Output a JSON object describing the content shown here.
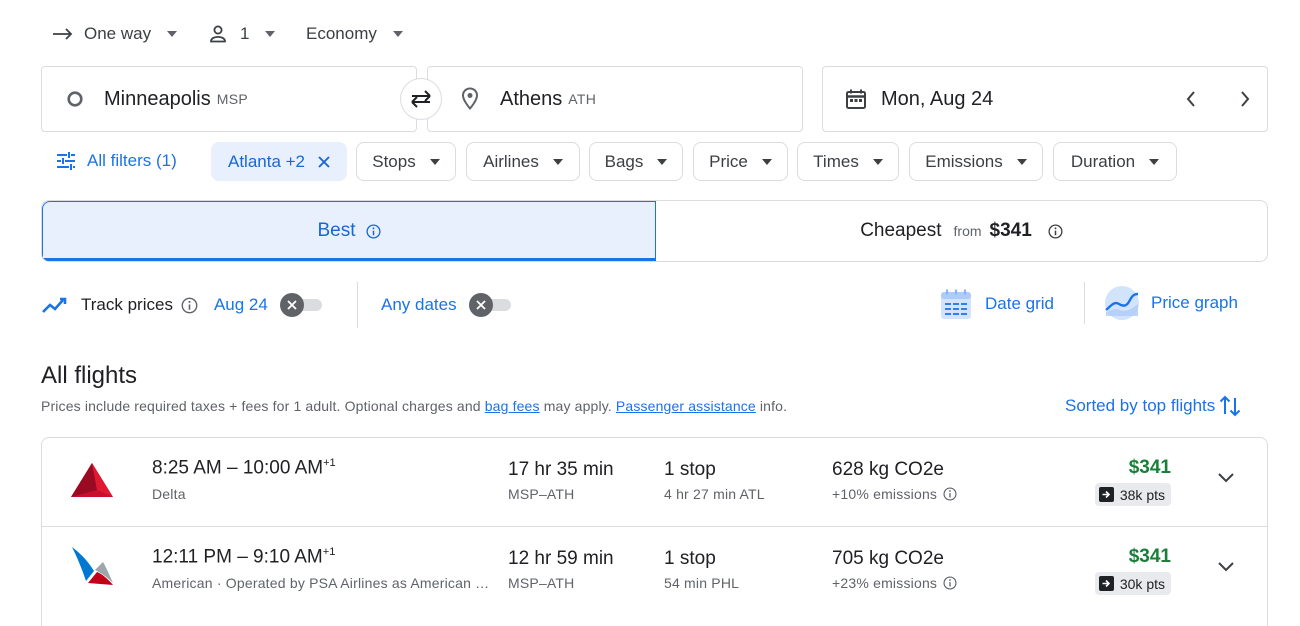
{
  "search": {
    "trip_type": "One way",
    "passengers": "1",
    "cabin": "Economy",
    "origin_city": "Minneapolis",
    "origin_code": "MSP",
    "dest_city": "Athens",
    "dest_code": "ATH",
    "date": "Mon, Aug 24"
  },
  "filters": {
    "all_filters": "All filters (1)",
    "active_chip": "Atlanta +2",
    "chips": [
      "Stops",
      "Airlines",
      "Bags",
      "Price",
      "Times",
      "Emissions",
      "Duration"
    ]
  },
  "tabs": {
    "best": "Best",
    "cheapest": "Cheapest",
    "from": "from",
    "cheapest_price": "$341"
  },
  "tracking": {
    "label": "Track prices",
    "date": "Aug 24",
    "any_dates": "Any dates",
    "date_grid": "Date grid",
    "price_graph": "Price graph"
  },
  "results": {
    "heading": "All flights",
    "note_a": "Prices include required taxes + fees for 1 adult. Optional charges and ",
    "bag_fees": "bag fees",
    "note_b": " may apply. ",
    "passenger_assistance": "Passenger assistance",
    "note_c": " info.",
    "sort_label": "Sorted by top flights"
  },
  "flights": [
    {
      "depart": "8:25 AM",
      "arrive": "10:00 AM",
      "day_offset": "+1",
      "airline": "Delta",
      "duration": "17 hr 35 min",
      "route": "MSP–ATH",
      "stops": "1 stop",
      "layover": "4 hr 27 min ATL",
      "emissions": "628 kg CO2e",
      "emissions_delta": "+10% emissions",
      "price": "$341",
      "points": "38k pts"
    },
    {
      "depart": "12:11 PM",
      "arrive": "9:10 AM",
      "day_offset": "+1",
      "airline": "American · Operated by PSA Airlines as American …",
      "duration": "12 hr 59 min",
      "route": "MSP–ATH",
      "stops": "1 stop",
      "layover": "54 min PHL",
      "emissions": "705 kg CO2e",
      "emissions_delta": "+23% emissions",
      "price": "$341",
      "points": "30k pts"
    }
  ],
  "colors": {
    "accent": "#1a73e8",
    "price_green": "#188038",
    "chip_active_bg": "#e8f0fe",
    "delta_red": "#c8102e",
    "american_blue": "#0078d2"
  }
}
